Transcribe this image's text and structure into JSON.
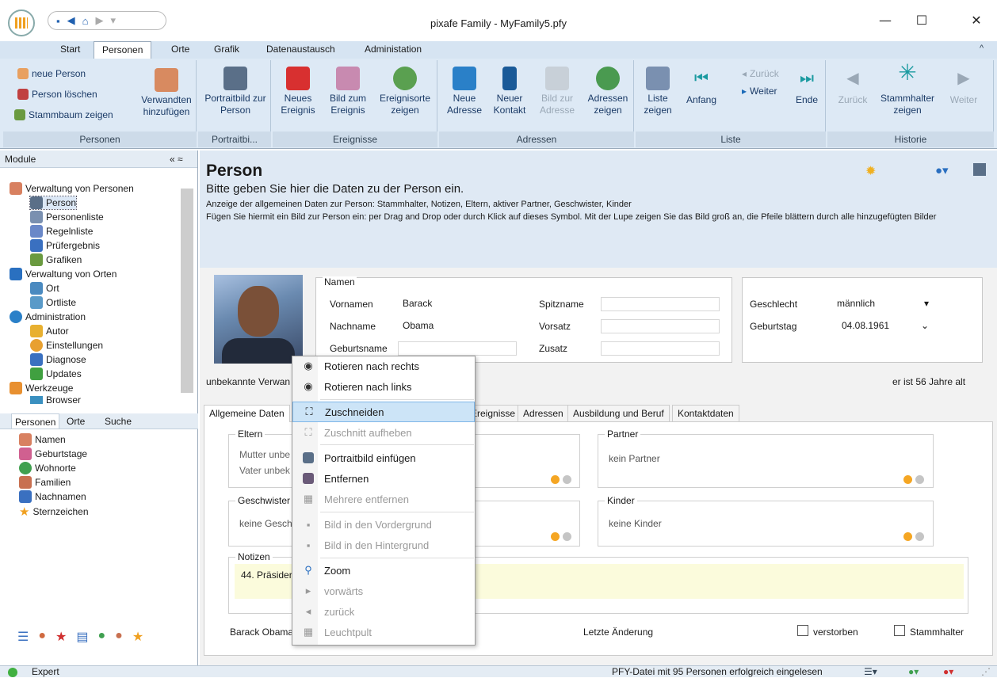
{
  "window": {
    "title": "pixafe Family - MyFamily5.pfy",
    "minimize": "—",
    "maximize": "☐",
    "close": "✕"
  },
  "ribbon_tabs": [
    "Start",
    "Personen",
    "Orte",
    "Grafik",
    "Datenaustausch",
    "Administation"
  ],
  "ribbon": {
    "personen": {
      "neue_person": "neue Person",
      "person_loeschen": "Person löschen",
      "stammbaum": "Stammbaum zeigen",
      "verwandten": "Verwandten hinzufügen",
      "label": "Personen"
    },
    "portrait": {
      "btn": "Portraitbild zur Person",
      "label": "Portraitbi..."
    },
    "ereignisse": {
      "neues": "Neues Ereignis",
      "bild": "Bild zum Ereignis",
      "orte": "Ereignisorte zeigen",
      "label": "Ereignisse"
    },
    "adressen": {
      "neue": "Neue Adresse",
      "kontakt": "Neuer Kontakt",
      "bild": "Bild zur Adresse",
      "zeigen": "Adressen zeigen",
      "label": "Adressen"
    },
    "liste": {
      "liste": "Liste zeigen",
      "anfang": "Anfang",
      "zurueck": "Zurück",
      "weiter": "Weiter",
      "ende": "Ende",
      "label": "Liste"
    },
    "historie": {
      "zurueck": "Zurück",
      "stamm": "Stammhalter zeigen",
      "weiter": "Weiter",
      "label": "Historie"
    }
  },
  "modules": {
    "title": "Module",
    "items": [
      "Verwaltung von Personen",
      "Person",
      "Personenliste",
      "Regelnliste",
      "Prüfergebnis",
      "Grafiken",
      "Verwaltung von Orten",
      "Ort",
      "Ortliste",
      "Administration",
      "Autor",
      "Einstellungen",
      "Diagnose",
      "Updates",
      "Werkzeuge",
      "Browser"
    ]
  },
  "nav_tabs": [
    "Personen",
    "Orte",
    "Suche"
  ],
  "nav_tree": [
    "Namen",
    "Geburtstage",
    "Wohnorte",
    "Familien",
    "Nachnamen",
    "Sternzeichen"
  ],
  "page": {
    "title": "Person",
    "subtitle": "Bitte geben Sie hier die Daten zu der Person ein.",
    "desc1": "Anzeige der allgemeinen Daten zur Person: Stammhalter, Notizen, Eltern, aktiver Partner, Geschwister, Kinder",
    "desc2": "Fügen Sie hiermit ein Bild zur Person ein: per Drag and Drop oder durch Klick auf dieses Symbol. Mit der Lupe zeigen Sie das Bild groß an, die Pfeile blättern durch alle hinzugefügten Bilder"
  },
  "form": {
    "namen": "Namen",
    "vornamen_label": "Vornamen",
    "vornamen": "Barack",
    "nachname_label": "Nachname",
    "nachname": "Obama",
    "geburtsname_label": "Geburtsname",
    "spitzname_label": "Spitzname",
    "vorsatz_label": "Vorsatz",
    "zusatz_label": "Zusatz",
    "geschlecht_label": "Geschlecht",
    "geschlecht": "männlich",
    "geburtstag_label": "Geburtstag",
    "geburtstag": "04.08.1961",
    "verwandtschaft": "unbekannte Verwan",
    "alter": "er ist 56 Jahre alt"
  },
  "detail_tabs": [
    "Allgemeine Daten",
    "Ereignisse",
    "Adressen",
    "Ausbildung und Beruf",
    "Kontaktdaten"
  ],
  "groups": {
    "eltern": "Eltern",
    "mutter": "Mutter unbe",
    "vater": "Vater unbek",
    "partner": "Partner",
    "kein_partner": "kein Partner",
    "geschwister": "Geschwister",
    "keine_geschwister": "keine Gesch",
    "kinder": "Kinder",
    "keine_kinder": "keine Kinder",
    "notizen": "Notizen",
    "notiz": "44. Präsider"
  },
  "footer": {
    "name": "Barack Obama",
    "letzte": "Letzte Änderung",
    "verstorben": "verstorben",
    "stammhalter": "Stammhalter"
  },
  "context_menu": [
    {
      "label": "Rotieren nach rechts",
      "icon": "rotate-right-icon",
      "enabled": true
    },
    {
      "label": "Rotieren nach links",
      "icon": "rotate-left-icon",
      "enabled": true
    },
    {
      "label": "Zuschneiden",
      "icon": "crop-icon",
      "enabled": true,
      "highlight": true
    },
    {
      "label": "Zuschnitt aufheben",
      "icon": "uncrop-icon",
      "enabled": false
    },
    {
      "label": "Portraitbild einfügen",
      "icon": "portrait-insert-icon",
      "enabled": true
    },
    {
      "label": "Entfernen",
      "icon": "remove-portrait-icon",
      "enabled": true
    },
    {
      "label": "Mehrere entfernen",
      "icon": "remove-multiple-icon",
      "enabled": false
    },
    {
      "label": "Bild in den Vordergrund",
      "icon": "bring-front-icon",
      "enabled": false
    },
    {
      "label": "Bild in den Hintergrund",
      "icon": "send-back-icon",
      "enabled": false
    },
    {
      "label": "Zoom",
      "icon": "zoom-icon",
      "enabled": true
    },
    {
      "label": "vorwärts",
      "icon": "forward-icon",
      "enabled": false
    },
    {
      "label": "zurück",
      "icon": "back-icon",
      "enabled": false
    },
    {
      "label": "Leuchtpult",
      "icon": "lightbox-icon",
      "enabled": false
    }
  ],
  "status": {
    "mode": "Expert",
    "message": "PFY-Datei mit 95 Personen erfolgreich eingelesen"
  },
  "colors": {
    "ribbon_bg": "#dde9f5",
    "accent": "#2a6fc0",
    "highlight": "#cce4f7"
  }
}
